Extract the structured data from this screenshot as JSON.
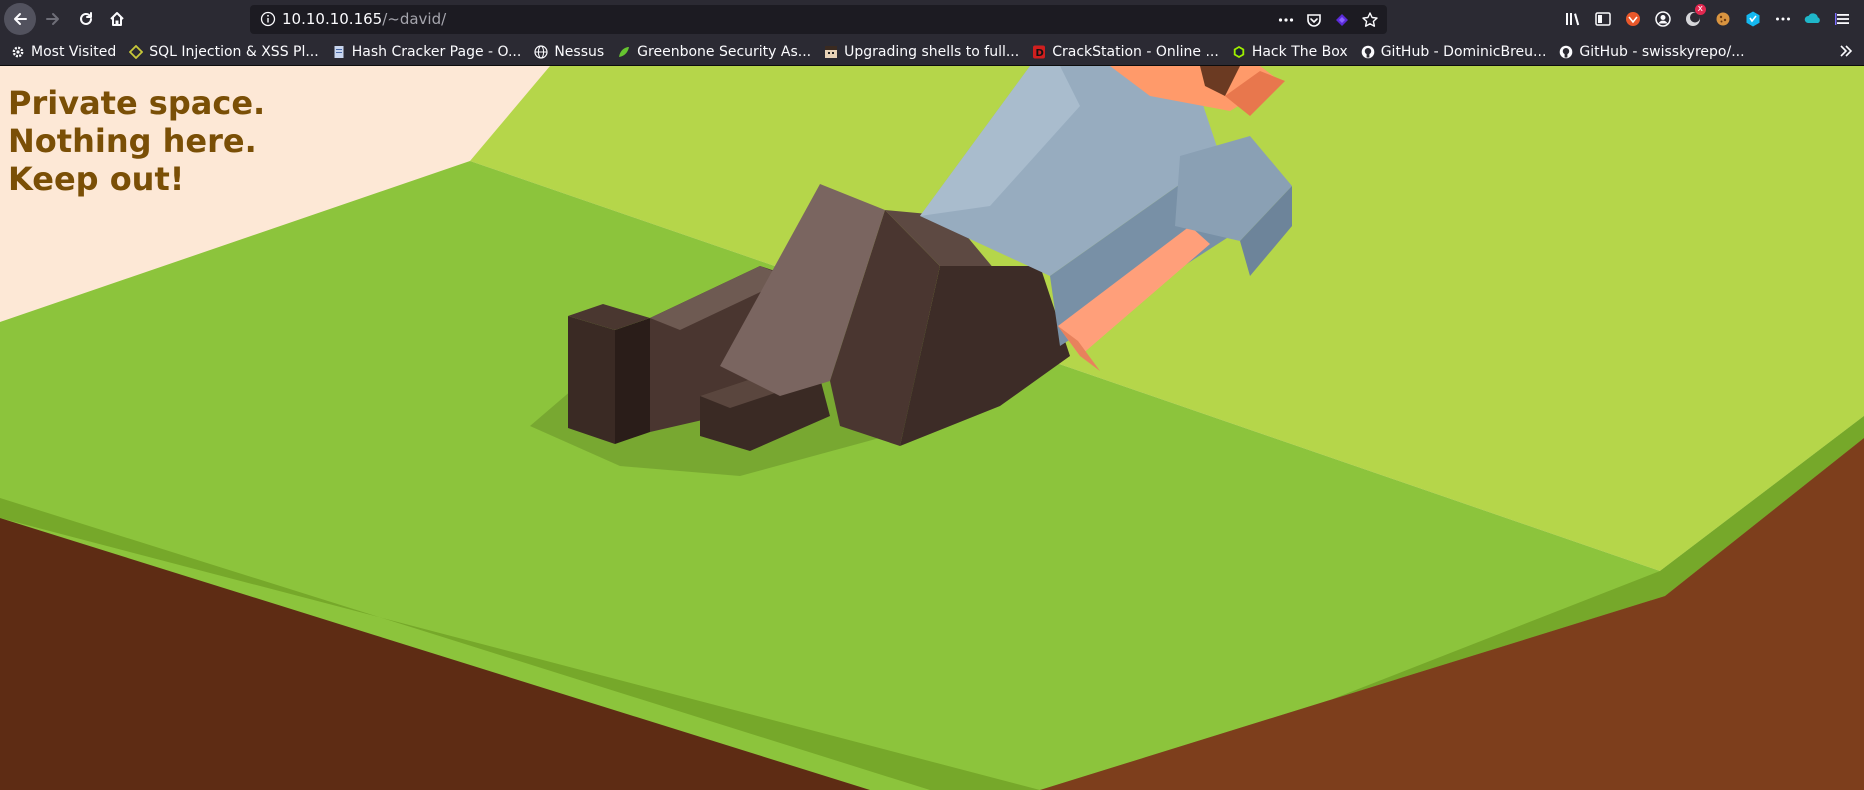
{
  "browser": {
    "url": {
      "host": "10.10.10.165",
      "path": "/~david/"
    },
    "extensions": {
      "badge_count": "x"
    },
    "bookmarks": [
      {
        "label": "Most Visited",
        "icon": "gear-icon"
      },
      {
        "label": "SQL Injection & XSS Pl...",
        "icon": "diamond-icon"
      },
      {
        "label": "Hash Cracker Page - O...",
        "icon": "document-icon"
      },
      {
        "label": "Nessus",
        "icon": "globe-icon"
      },
      {
        "label": "Greenbone Security As...",
        "icon": "greenbone-icon"
      },
      {
        "label": "Upgrading shells to full...",
        "icon": "avatar-icon"
      },
      {
        "label": "CrackStation - Online ...",
        "icon": "crackstation-icon"
      },
      {
        "label": "Hack The Box",
        "icon": "htb-icon"
      },
      {
        "label": "GitHub - DominicBreu...",
        "icon": "github-icon"
      },
      {
        "label": "GitHub - swisskyrepo/...",
        "icon": "github-icon"
      }
    ]
  },
  "page": {
    "heading_lines": [
      "Private space.",
      "Nothing here.",
      "Keep out!"
    ]
  },
  "colors": {
    "heading": "#7a4f06",
    "grass": "#8cc43c",
    "grass_light": "#b5d64a",
    "dirt": "#6b3418",
    "background": "#fde8d6"
  }
}
